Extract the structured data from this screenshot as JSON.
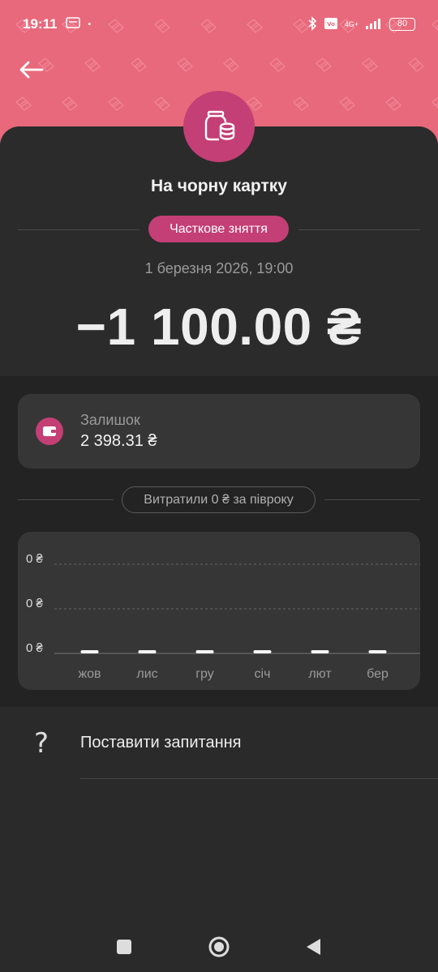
{
  "status_bar": {
    "time": "19:11",
    "network": "4G+",
    "battery": "80"
  },
  "header": {
    "title": "На чорну картку",
    "type_badge": "Часткове зняття",
    "datetime": "1 березня 2026, 19:00",
    "amount": "−1 100.00 ₴"
  },
  "balance": {
    "label": "Залишок",
    "value": "2 398.31 ₴"
  },
  "spent": {
    "label": "Витратили 0 ₴ за півроку"
  },
  "chart_data": {
    "type": "bar",
    "categories": [
      "жов",
      "лис",
      "гру",
      "січ",
      "лют",
      "бер"
    ],
    "values": [
      0,
      0,
      0,
      0,
      0,
      0
    ],
    "y_tick_labels": [
      "0 ₴",
      "0 ₴",
      "0 ₴"
    ],
    "grid": true
  },
  "help": {
    "label": "Поставити запитання"
  },
  "colors": {
    "header_bg": "#e8697b",
    "accent": "#c43f76",
    "background": "#2a2a2a",
    "card": "#363636"
  },
  "icons": {
    "back": "arrow-left-icon",
    "jar": "jar-coins-icon",
    "wallet": "wallet-icon",
    "question": "question-mark-icon",
    "nav_recent": "square-icon",
    "nav_home": "circle-icon",
    "nav_back": "triangle-back-icon"
  }
}
